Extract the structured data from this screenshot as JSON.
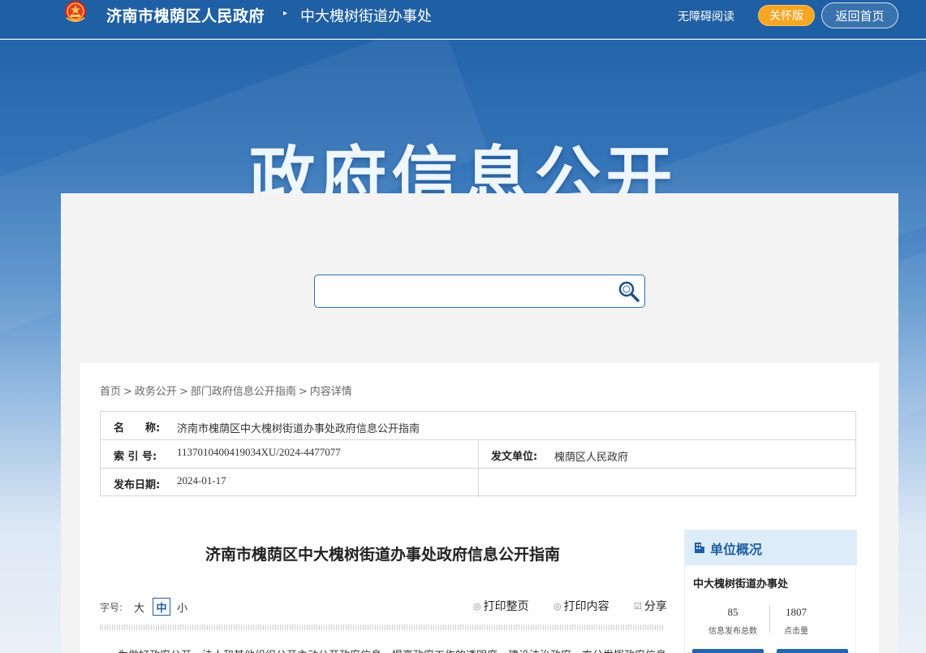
{
  "header": {
    "site_name": "济南市槐荫区人民政府",
    "arrow": "▸",
    "sub_name": "中大槐树街道办事处",
    "accessible_reading": "无障碍阅读",
    "care_mode": "关怀版",
    "back_home": "返回首页"
  },
  "banner": {
    "title": "政府信息公开"
  },
  "search": {
    "placeholder": ""
  },
  "breadcrumb": {
    "items": [
      "首页",
      "政务公开",
      "部门政府信息公开指南",
      "内容详情"
    ],
    "separator": ">"
  },
  "meta": {
    "name_label": "名　　称:",
    "name_value": "济南市槐荫区中大槐树街道办事处政府信息公开指南",
    "index_label": "索 引 号:",
    "index_value": "1137010400419034XU/2024-4477077",
    "issuer_label": "发文单位:",
    "issuer_value": "槐荫区人民政府",
    "date_label": "发布日期:",
    "date_value": "2024-01-17"
  },
  "article": {
    "title": "济南市槐荫区中大槐树街道办事处政府信息公开指南",
    "font_size_label": "字号:",
    "font_sizes": [
      "大",
      "中",
      "小"
    ],
    "print_page": "打印整页",
    "print_content": "打印内容",
    "share": "分享",
    "first_line": "为做好政府公开，法人和其他组织公开主动公开政府信息，提高政府工作的透明度，建设法治政府，充分发挥政府信息"
  },
  "sidebar": {
    "heading": "单位概况",
    "org_name": "中大槐树街道办事处",
    "stats": [
      {
        "value": "85",
        "label": "信息发布总数"
      },
      {
        "value": "1807",
        "label": "点击量"
      }
    ]
  },
  "colors": {
    "header_bg": "#1f5fa3",
    "care_orange": "#f6a623",
    "accent_blue": "#1f5fa3",
    "sidebar_head_bg": "#ddecf9"
  }
}
